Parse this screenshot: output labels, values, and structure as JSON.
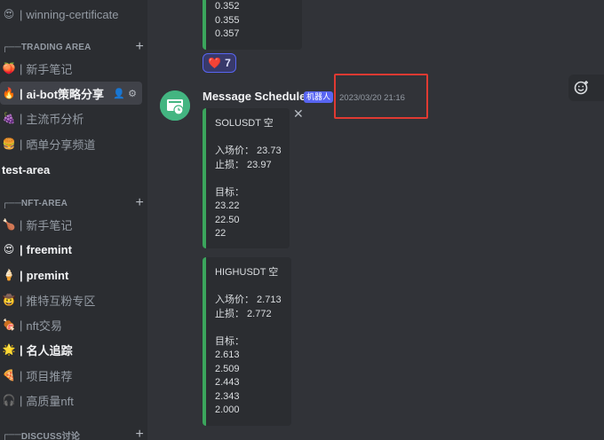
{
  "sidebar": {
    "channels_top": [
      {
        "name": "winning-certificate",
        "emoji": "😍"
      }
    ],
    "trading_area": {
      "label": "TRADING AREA",
      "channels": [
        {
          "name": "新手笔记",
          "emoji": "🍑"
        },
        {
          "name": "ai-bot策略分享",
          "emoji": "🔥"
        },
        {
          "name": "主流币分析",
          "emoji": "🍇"
        },
        {
          "name": "晒单分享频道",
          "emoji": "🍔"
        },
        {
          "name": "test-area",
          "emoji": ""
        }
      ]
    },
    "nft_area": {
      "label": "NFT-AREA",
      "channels": [
        {
          "name": "新手笔记",
          "emoji": "🍗"
        },
        {
          "name": "freemint",
          "emoji": "😍"
        },
        {
          "name": "premint",
          "emoji": "🍦"
        },
        {
          "name": "推特互粉专区",
          "emoji": "🤠"
        },
        {
          "name": "nft交易",
          "emoji": "🍖"
        },
        {
          "name": "名人追踪",
          "emoji": "🌟"
        },
        {
          "name": "项目推荐",
          "emoji": "🍕"
        },
        {
          "name": "高质量nft",
          "emoji": "🎧"
        }
      ]
    },
    "discuss": {
      "label": "DISCUSS讨论"
    }
  },
  "prev_embed": {
    "lines": [
      "0.352",
      "0.355",
      "0.357"
    ]
  },
  "reaction": {
    "emoji": "❤️",
    "count": "7"
  },
  "message": {
    "author": "Message Scheduler",
    "bot_tag": "机器人",
    "timestamp": "2023/03/20 21:16"
  },
  "embed1": {
    "lines": [
      "SOLUSDT 空",
      "",
      "入场价： 23.73",
      "止损： 23.97",
      "",
      "目标：",
      "23.22",
      "22.50",
      "22"
    ]
  },
  "embed2": {
    "lines": [
      "HIGHUSDT 空",
      "",
      "入场价： 2.713",
      "止损： 2.772",
      "",
      "目标：",
      "2.613",
      "2.509",
      "2.443",
      "2.343",
      "2.000"
    ]
  },
  "colors": {
    "accent_green": "#3ba55c",
    "highlight_red": "#e03a32",
    "bot_tag": "#5865f2"
  }
}
